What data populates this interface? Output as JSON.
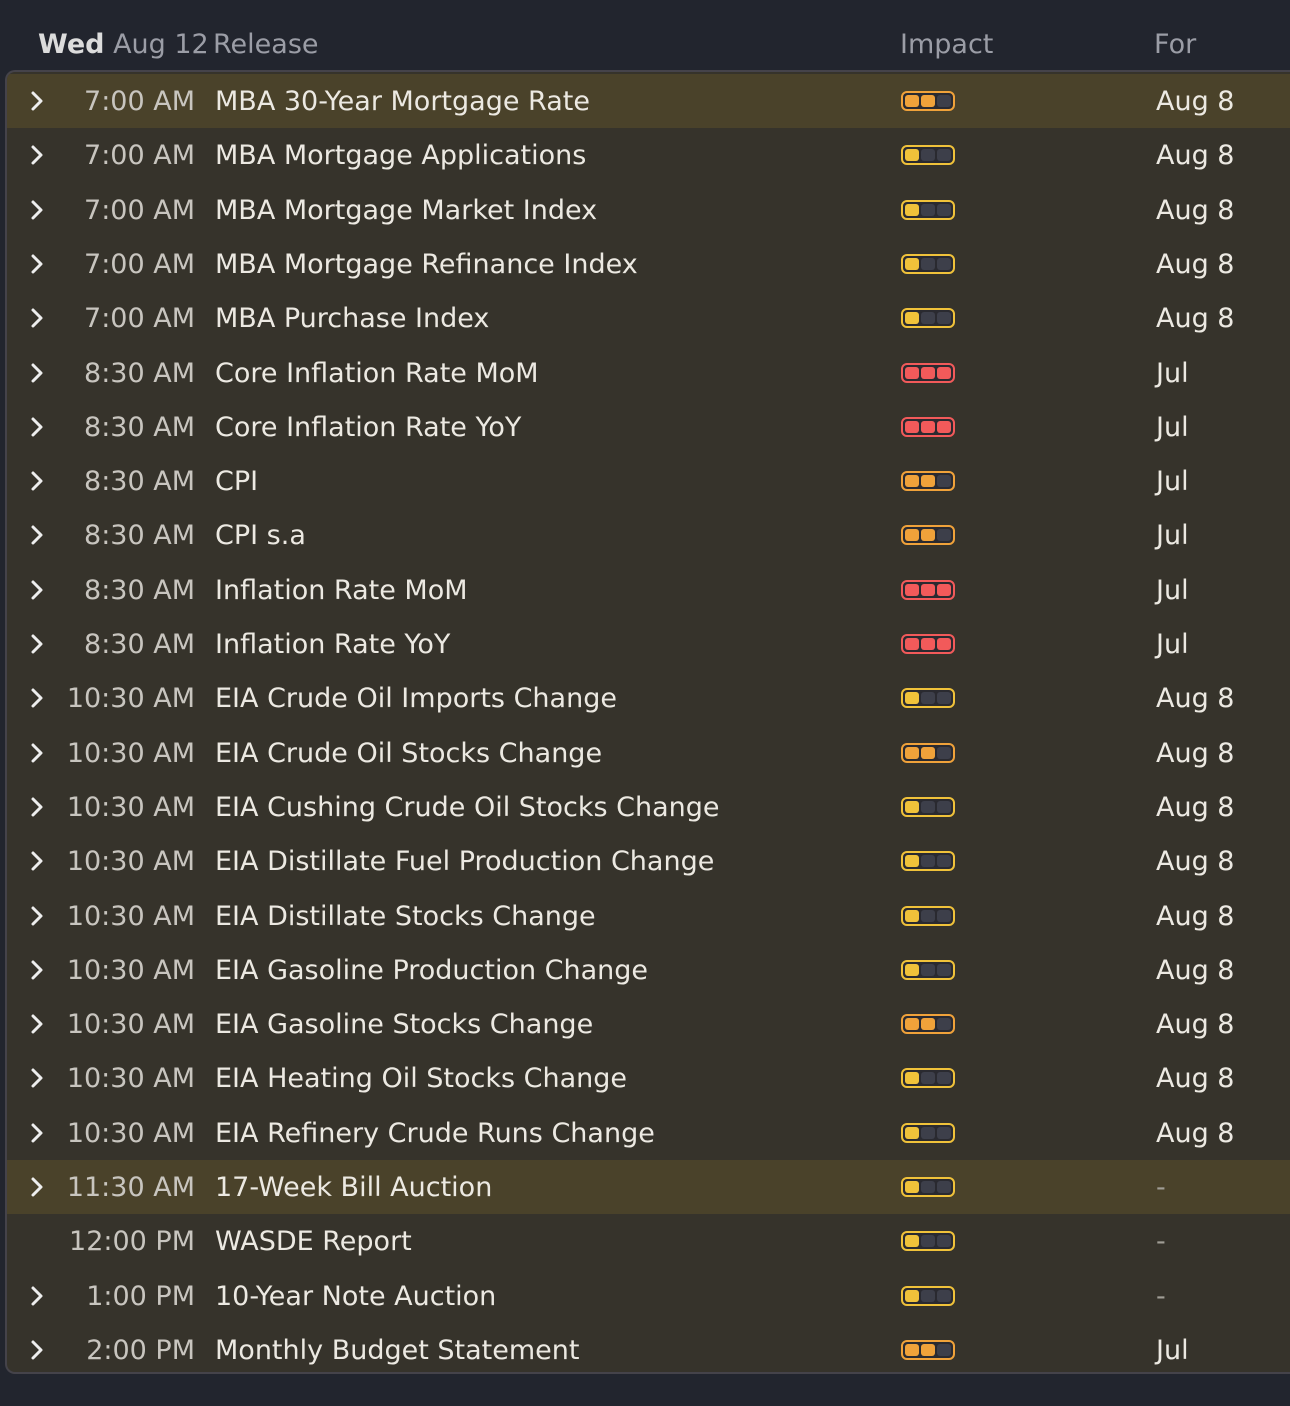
{
  "header": {
    "day": "Wed",
    "date": "Aug 12",
    "release": "Release",
    "impact": "Impact",
    "for": "For"
  },
  "impact_colors": {
    "low": "#f0c23a",
    "medium": "#f0a23a",
    "high": "#f25a5a"
  },
  "rows": [
    {
      "time": "7:00 AM",
      "name": "MBA 30-Year Mortgage Rate",
      "impact": 2,
      "for": "Aug 8",
      "expandable": true,
      "highlight": true
    },
    {
      "time": "7:00 AM",
      "name": "MBA Mortgage Applications",
      "impact": 1,
      "for": "Aug 8",
      "expandable": true,
      "highlight": false
    },
    {
      "time": "7:00 AM",
      "name": "MBA Mortgage Market Index",
      "impact": 1,
      "for": "Aug 8",
      "expandable": true,
      "highlight": false
    },
    {
      "time": "7:00 AM",
      "name": "MBA Mortgage Refinance Index",
      "impact": 1,
      "for": "Aug 8",
      "expandable": true,
      "highlight": false
    },
    {
      "time": "7:00 AM",
      "name": "MBA Purchase Index",
      "impact": 1,
      "for": "Aug 8",
      "expandable": true,
      "highlight": false
    },
    {
      "time": "8:30 AM",
      "name": "Core Inflation Rate MoM",
      "impact": 3,
      "for": "Jul",
      "expandable": true,
      "highlight": false
    },
    {
      "time": "8:30 AM",
      "name": "Core Inflation Rate YoY",
      "impact": 3,
      "for": "Jul",
      "expandable": true,
      "highlight": false
    },
    {
      "time": "8:30 AM",
      "name": "CPI",
      "impact": 2,
      "for": "Jul",
      "expandable": true,
      "highlight": false
    },
    {
      "time": "8:30 AM",
      "name": "CPI s.a",
      "impact": 2,
      "for": "Jul",
      "expandable": true,
      "highlight": false
    },
    {
      "time": "8:30 AM",
      "name": "Inflation Rate MoM",
      "impact": 3,
      "for": "Jul",
      "expandable": true,
      "highlight": false
    },
    {
      "time": "8:30 AM",
      "name": "Inflation Rate YoY",
      "impact": 3,
      "for": "Jul",
      "expandable": true,
      "highlight": false
    },
    {
      "time": "10:30 AM",
      "name": "EIA Crude Oil Imports Change",
      "impact": 1,
      "for": "Aug 8",
      "expandable": true,
      "highlight": false
    },
    {
      "time": "10:30 AM",
      "name": "EIA Crude Oil Stocks Change",
      "impact": 2,
      "for": "Aug 8",
      "expandable": true,
      "highlight": false
    },
    {
      "time": "10:30 AM",
      "name": "EIA Cushing Crude Oil Stocks Change",
      "impact": 1,
      "for": "Aug 8",
      "expandable": true,
      "highlight": false
    },
    {
      "time": "10:30 AM",
      "name": "EIA Distillate Fuel Production Change",
      "impact": 1,
      "for": "Aug 8",
      "expandable": true,
      "highlight": false
    },
    {
      "time": "10:30 AM",
      "name": "EIA Distillate Stocks Change",
      "impact": 1,
      "for": "Aug 8",
      "expandable": true,
      "highlight": false
    },
    {
      "time": "10:30 AM",
      "name": "EIA Gasoline Production Change",
      "impact": 1,
      "for": "Aug 8",
      "expandable": true,
      "highlight": false
    },
    {
      "time": "10:30 AM",
      "name": "EIA Gasoline Stocks Change",
      "impact": 2,
      "for": "Aug 8",
      "expandable": true,
      "highlight": false
    },
    {
      "time": "10:30 AM",
      "name": "EIA Heating Oil Stocks Change",
      "impact": 1,
      "for": "Aug 8",
      "expandable": true,
      "highlight": false
    },
    {
      "time": "10:30 AM",
      "name": "EIA Refinery Crude Runs Change",
      "impact": 1,
      "for": "Aug 8",
      "expandable": true,
      "highlight": false
    },
    {
      "time": "11:30 AM",
      "name": "17-Week Bill Auction",
      "impact": 1,
      "for": "-",
      "expandable": true,
      "highlight": true
    },
    {
      "time": "12:00 PM",
      "name": "WASDE Report",
      "impact": 1,
      "for": "-",
      "expandable": false,
      "highlight": false
    },
    {
      "time": "1:00 PM",
      "name": "10-Year Note Auction",
      "impact": 1,
      "for": "-",
      "expandable": true,
      "highlight": false
    },
    {
      "time": "2:00 PM",
      "name": "Monthly Budget Statement",
      "impact": 2,
      "for": "Jul",
      "expandable": true,
      "highlight": false
    }
  ]
}
